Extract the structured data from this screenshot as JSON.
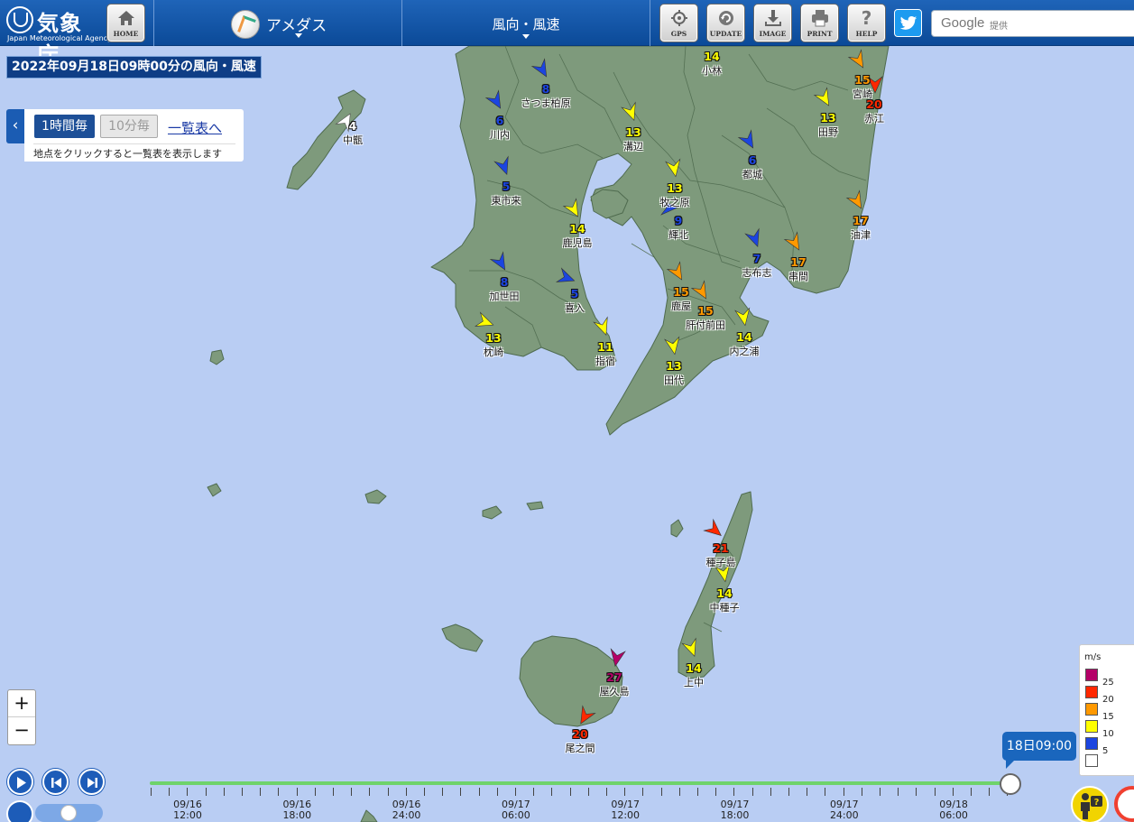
{
  "header": {
    "logo_name": "気象庁",
    "logo_sub": "Japan Meteorological Agency",
    "home_label": "HOME",
    "amedas_label": "アメダス",
    "element_label": "風向・風速",
    "gps_label": "GPS",
    "update_label": "UPDATE",
    "image_label": "IMAGE",
    "print_label": "PRINT",
    "help_label": "HELP",
    "search_brand": "Google",
    "search_provider": "提供"
  },
  "title": "2022年09月18日09時00分の風向・風速",
  "panel": {
    "btn_hourly": "1時間毎",
    "btn_10min": "10分毎",
    "list_link": "一覧表へ",
    "hint": "地点をクリックすると一覧表を表示します"
  },
  "colors": {
    "sea": "#b9cdf3",
    "land": "#7e9a7c",
    "white": "#ffffff",
    "blue": "#1b45e0",
    "yellow": "#ffff00",
    "orange": "#ff9900",
    "red": "#ff2800",
    "purple": "#b40068"
  },
  "stations": [
    {
      "name": "中甑",
      "value": "4",
      "cat": "white",
      "dir": 300
    },
    {
      "name": "さつま柏原",
      "value": "8",
      "cat": "blue",
      "dir": 60
    },
    {
      "name": "川内",
      "value": "6",
      "cat": "blue",
      "dir": 60
    },
    {
      "name": "東市来",
      "value": "5",
      "cat": "blue",
      "dir": 70
    },
    {
      "name": "加世田",
      "value": "8",
      "cat": "blue",
      "dir": 60
    },
    {
      "name": "枕崎",
      "value": "13",
      "cat": "yellow",
      "dir": 20
    },
    {
      "name": "鹿児島",
      "value": "14",
      "cat": "yellow",
      "dir": 60
    },
    {
      "name": "喜入",
      "value": "5",
      "cat": "blue",
      "dir": 20
    },
    {
      "name": "指宿",
      "value": "11",
      "cat": "yellow",
      "dir": 70
    },
    {
      "name": "溝辺",
      "value": "13",
      "cat": "yellow",
      "dir": 70
    },
    {
      "name": "牧之原",
      "value": "13",
      "cat": "yellow",
      "dir": 80
    },
    {
      "name": "輝北",
      "value": "9",
      "cat": "blue",
      "dir": 0
    },
    {
      "name": "鹿屋",
      "value": "15",
      "cat": "orange",
      "dir": 60
    },
    {
      "name": "肝付前田",
      "value": "15",
      "cat": "orange",
      "dir": 60
    },
    {
      "name": "内之浦",
      "value": "14",
      "cat": "yellow",
      "dir": 80
    },
    {
      "name": "田代",
      "value": "13",
      "cat": "yellow",
      "dir": 80
    },
    {
      "name": "志布志",
      "value": "7",
      "cat": "blue",
      "dir": 70
    },
    {
      "name": "串間",
      "value": "17",
      "cat": "orange",
      "dir": 60
    },
    {
      "name": "都城",
      "value": "6",
      "cat": "blue",
      "dir": 60
    },
    {
      "name": "小林",
      "value": "14",
      "cat": "yellow",
      "dir": 60
    },
    {
      "name": "田野",
      "value": "13",
      "cat": "yellow",
      "dir": 60
    },
    {
      "name": "宮崎",
      "value": "15",
      "cat": "orange",
      "dir": 60
    },
    {
      "name": "赤江",
      "value": "20",
      "cat": "red",
      "dir": 90
    },
    {
      "name": "油津",
      "value": "17",
      "cat": "orange",
      "dir": 60
    },
    {
      "name": "種子島",
      "value": "21",
      "cat": "red",
      "dir": 40
    },
    {
      "name": "中種子",
      "value": "14",
      "cat": "yellow",
      "dir": 80
    },
    {
      "name": "上中",
      "value": "14",
      "cat": "yellow",
      "dir": 70
    },
    {
      "name": "屋久島",
      "value": "27",
      "cat": "purple",
      "dir": 100
    },
    {
      "name": "尾之間",
      "value": "20",
      "cat": "red",
      "dir": 120
    }
  ],
  "timeline": {
    "current": "18日09:00",
    "labels": [
      {
        "date": "09/16",
        "time": "12:00"
      },
      {
        "date": "09/16",
        "time": "18:00"
      },
      {
        "date": "09/16",
        "time": "24:00"
      },
      {
        "date": "09/17",
        "time": "06:00"
      },
      {
        "date": "09/17",
        "time": "12:00"
      },
      {
        "date": "09/17",
        "time": "18:00"
      },
      {
        "date": "09/17",
        "time": "24:00"
      },
      {
        "date": "09/18",
        "time": "06:00"
      }
    ]
  },
  "legend": {
    "unit": "m/s",
    "items": [
      {
        "label": "25",
        "cat": "purple"
      },
      {
        "label": "20",
        "cat": "red"
      },
      {
        "label": "15",
        "cat": "orange"
      },
      {
        "label": "10",
        "cat": "yellow"
      },
      {
        "label": "5",
        "cat": "blue"
      },
      {
        "label": "",
        "cat": "white"
      }
    ]
  },
  "zoom": {
    "in": "+",
    "out": "−"
  }
}
